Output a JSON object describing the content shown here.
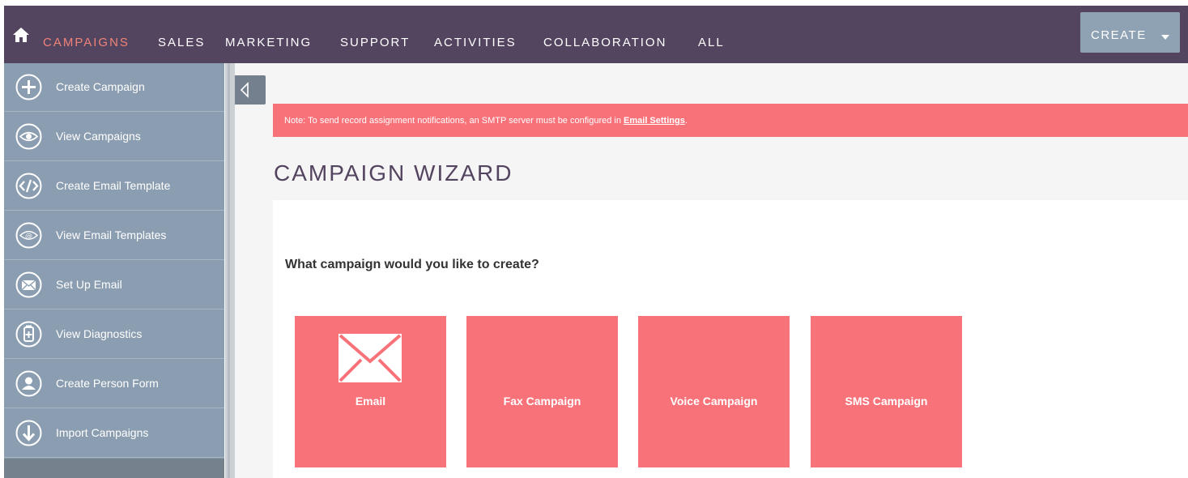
{
  "nav": {
    "items": [
      "CAMPAIGNS",
      "SALES",
      "MARKETING",
      "SUPPORT",
      "ACTIVITIES",
      "COLLABORATION",
      "ALL"
    ],
    "active": "CAMPAIGNS",
    "create_label": "CREATE"
  },
  "sidebar": {
    "items": [
      {
        "label": "Create Campaign",
        "icon": "plus-circle-icon"
      },
      {
        "label": "View Campaigns",
        "icon": "eye-icon"
      },
      {
        "label": "Create Email Template",
        "icon": "code-icon"
      },
      {
        "label": "View Email Templates",
        "icon": "email-view-icon"
      },
      {
        "label": "Set Up Email",
        "icon": "envelope-icon"
      },
      {
        "label": "View Diagnostics",
        "icon": "diagnostics-icon"
      },
      {
        "label": "Create Person Form",
        "icon": "person-icon"
      },
      {
        "label": "Import Campaigns",
        "icon": "download-arrow-icon"
      }
    ]
  },
  "alert": {
    "text": "Note: To send record assignment notifications, an SMTP server must be configured in ",
    "link": "Email Settings",
    "suffix": "."
  },
  "page": {
    "title": "CAMPAIGN WIZARD",
    "question": "What campaign would you like to create?"
  },
  "tiles": [
    {
      "label": "Email",
      "icon": "envelope-icon"
    },
    {
      "label": "Fax Campaign"
    },
    {
      "label": "Voice Campaign"
    },
    {
      "label": "SMS Campaign"
    }
  ],
  "colors": {
    "topbar": "#534460",
    "accent": "#f8727a",
    "sidebar": "#8b9db0",
    "active_nav": "#f08377"
  }
}
